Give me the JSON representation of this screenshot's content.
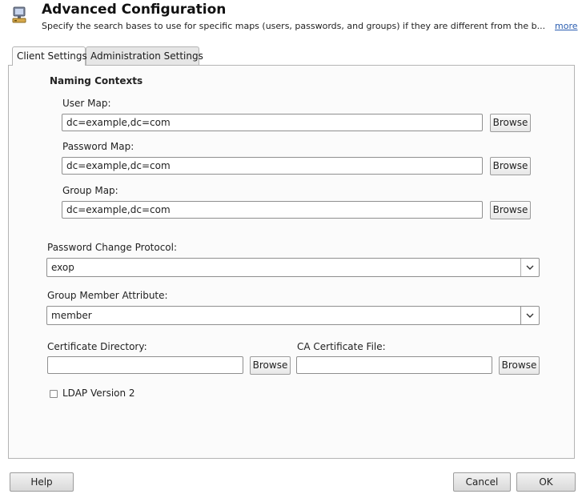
{
  "header": {
    "title": "Advanced Configuration",
    "description": "Specify the search bases to use for specific maps (users, passwords, and groups) if they are different from the b...",
    "more_link": "more",
    "icon": "computer-network-icon"
  },
  "tabs": [
    {
      "label": "Client Settings",
      "active": true
    },
    {
      "label": "Administration Settings",
      "active": false
    }
  ],
  "naming_contexts": {
    "heading": "Naming Contexts",
    "user_map": {
      "label": "User Map:",
      "value": "dc=example,dc=com",
      "browse_label": "Browse"
    },
    "password_map": {
      "label": "Password Map:",
      "value": "dc=example,dc=com",
      "browse_label": "Browse"
    },
    "group_map": {
      "label": "Group Map:",
      "value": "dc=example,dc=com",
      "browse_label": "Browse"
    }
  },
  "password_change_protocol": {
    "label": "Password Change Protocol:",
    "value": "exop"
  },
  "group_member_attribute": {
    "label": "Group Member Attribute:",
    "value": "member"
  },
  "certificate_directory": {
    "label": "Certificate Directory:",
    "value": "",
    "browse_label": "Browse"
  },
  "ca_certificate_file": {
    "label": "CA Certificate File:",
    "value": "",
    "browse_label": "Browse"
  },
  "ldap_version2": {
    "label": "LDAP Version 2",
    "checked": false
  },
  "footer": {
    "help": "Help",
    "cancel": "Cancel",
    "ok": "OK"
  }
}
